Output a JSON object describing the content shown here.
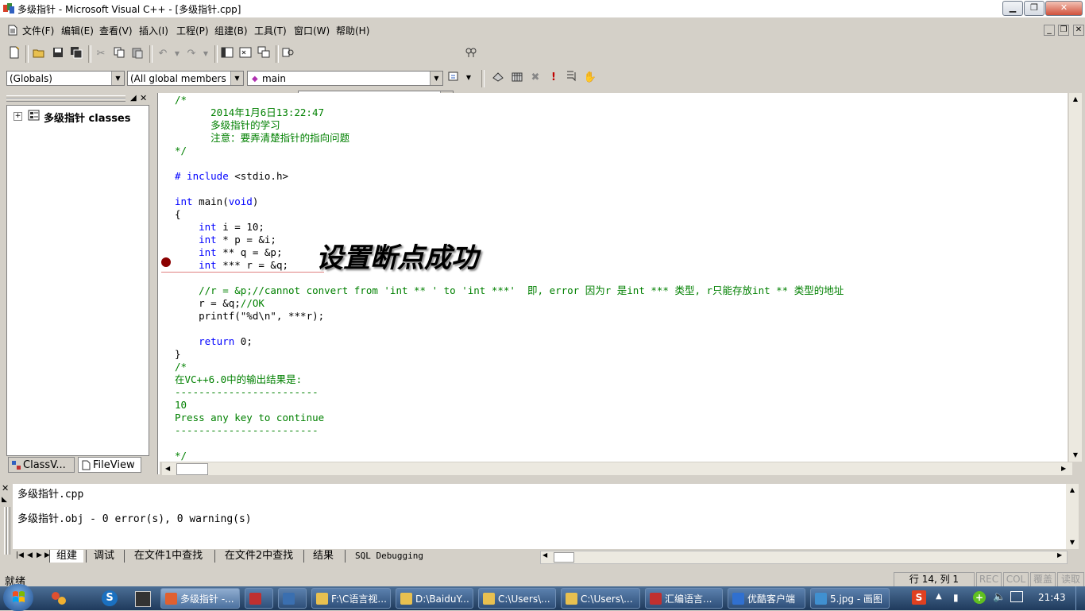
{
  "window": {
    "title": "多级指针 - Microsoft Visual C++ - [多级指针.cpp]",
    "minimize": "▁",
    "restore": "❐",
    "close": "✕",
    "doc_minimize": "_",
    "doc_restore": "❐",
    "doc_close": "✕"
  },
  "menu": [
    "文件(F)",
    "编辑(E)",
    "查看(V)",
    "插入(I)",
    "工程(P)",
    "组建(B)",
    "工具(T)",
    "窗口(W)",
    "帮助(H)"
  ],
  "toolbar2": {
    "scope": "(Globals)",
    "members": "(All global members",
    "function": "main"
  },
  "workspace": {
    "tree_root": "多级指针 classes",
    "tab_class": "ClassV...",
    "tab_file": "FileView"
  },
  "code": {
    "lines": [
      {
        "t": "/*",
        "c": "cm"
      },
      {
        "t": "      2014年1月6日13:22:47",
        "c": "cm"
      },
      {
        "t": "      多级指针的学习",
        "c": "cm"
      },
      {
        "t": "      注意：要弄清楚指针的指向问题",
        "c": "cm"
      },
      {
        "t": "*/",
        "c": "cm"
      },
      {
        "t": "",
        "c": ""
      },
      {
        "t": "# include <stdio.h>",
        "c": "pp"
      },
      {
        "t": "",
        "c": ""
      },
      {
        "t": "int main(void)",
        "c": "kwl"
      },
      {
        "t": "{",
        "c": ""
      },
      {
        "t": "    int i = 10;",
        "c": "kwi"
      },
      {
        "t": "    int * p = &i;",
        "c": "kwi"
      },
      {
        "t": "    int ** q = &p;",
        "c": "kwi"
      },
      {
        "t": "    int *** r = &q;",
        "c": "kwi"
      },
      {
        "t": "",
        "c": ""
      },
      {
        "t": "    //r = &p;//cannot convert from 'int ** ' to 'int ***'  即, error 因为r 是int *** 类型, r只能存放int ** 类型的地址",
        "c": "cm"
      },
      {
        "t": "    r = &q;//OK",
        "c": "mix"
      },
      {
        "t": "    printf(\"%d\\n\", ***r);",
        "c": ""
      },
      {
        "t": "",
        "c": ""
      },
      {
        "t": "    return 0;",
        "c": "kwr"
      },
      {
        "t": "}",
        "c": ""
      },
      {
        "t": "/*",
        "c": "cm"
      },
      {
        "t": "在VC++6.0中的输出结果是:",
        "c": "cm"
      },
      {
        "t": "------------------------",
        "c": "cm"
      },
      {
        "t": "10",
        "c": "cm"
      },
      {
        "t": "Press any key to continue",
        "c": "cm"
      },
      {
        "t": "------------------------",
        "c": "cm"
      },
      {
        "t": "",
        "c": ""
      },
      {
        "t": "*/",
        "c": "cm"
      }
    ],
    "annotation": "设置断点成功"
  },
  "output": {
    "line1": "多级指针.cpp",
    "line2": "多级指针.obj - 0 error(s), 0 warning(s)",
    "tabs": [
      "组建",
      "调试",
      "在文件1中查找",
      "在文件2中查找",
      "结果",
      "SQL Debugging"
    ]
  },
  "status": {
    "left": "就绪",
    "position": "行 14, 列 1",
    "rec": "REC",
    "col": "COL",
    "ovr": "覆盖",
    "read": "读取"
  },
  "taskbar": {
    "items": [
      {
        "label": "多级指针 -...",
        "color": "#e06030",
        "active": true
      },
      {
        "label": "",
        "color": "#c03030",
        "active": false
      },
      {
        "label": "",
        "color": "#3a6fb0",
        "active": false
      },
      {
        "label": "F:\\C语言视...",
        "color": "#e8c050",
        "active": false
      },
      {
        "label": "D:\\BaiduY...",
        "color": "#e8c050",
        "active": false
      },
      {
        "label": "C:\\Users\\...",
        "color": "#e8c050",
        "active": false
      },
      {
        "label": "C:\\Users\\...",
        "color": "#e8c050",
        "active": false
      },
      {
        "label": "汇编语言...",
        "color": "#c03030",
        "active": false
      },
      {
        "label": "优酷客户端",
        "color": "#3070d0",
        "active": false
      },
      {
        "label": "5.jpg - 画图",
        "color": "#4090d0",
        "active": false
      }
    ],
    "clock": "21:43",
    "ime": "S"
  }
}
